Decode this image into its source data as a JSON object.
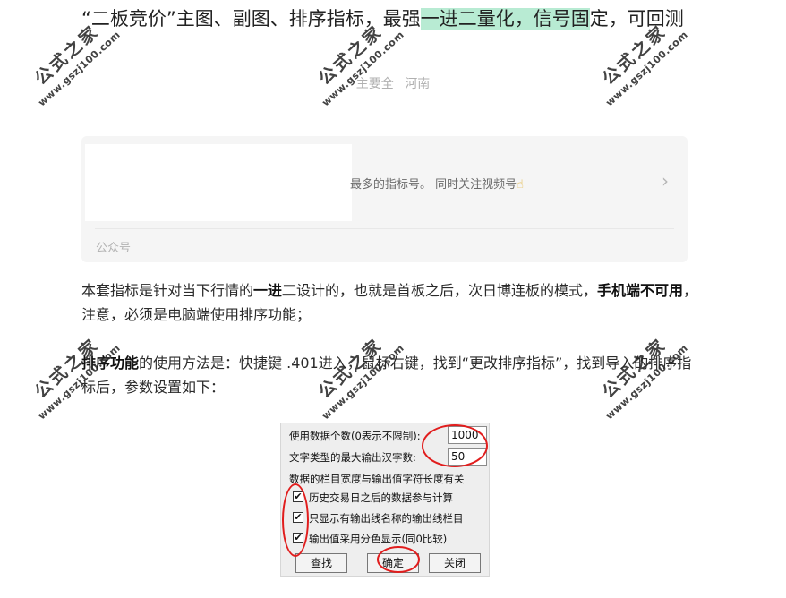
{
  "article": {
    "title_part1": "“二板竞价”主图、副图、排序指标，最强",
    "title_highlight": "一进二量化，信号固",
    "title_part2": "定，可回测",
    "meta_prefix": "主要全",
    "meta_location": "河南"
  },
  "card": {
    "description": "最多的指标号。 同时关注视频号",
    "hand_icon": "pointing-hand-icon",
    "chevron": "›",
    "source": "公众号"
  },
  "body": {
    "p1_a": "本套指标是针对当下行情的",
    "p1_b": "一进二",
    "p1_c": "设计的，也就是首板之后，次日博连板的模式，",
    "p1_d": "手机端不可用",
    "p1_e": "，注意，必须是电脑端使用排序功能；",
    "p2_a": "排序功能",
    "p2_b": "的使用方法是：快捷键 .401进入，鼠标右键，找到“更改排序指标”，找到导入的排序指标后，参数设置如下："
  },
  "dialog": {
    "data_count_label": "使用数据个数(0表示不限制):",
    "data_count_value": "1000",
    "max_chars_label": "文字类型的最大输出汉字数:",
    "max_chars_value": "50",
    "note": "数据的栏目宽度与输出值字符长度有关",
    "options": [
      {
        "label": "历史交易日之后的数据参与计算",
        "checked": true
      },
      {
        "label": "只显示有输出线名称的输出线栏目",
        "checked": true
      },
      {
        "label": "输出值采用分色显示(同0比较)",
        "checked": true
      }
    ],
    "check_mark": "✔",
    "find_button": "查找",
    "ok_button": "确定",
    "close_button": "关闭"
  },
  "watermark": {
    "title": "公式之家",
    "url": "www.gszj100.com"
  },
  "colors": {
    "highlight": "#b8ebd3",
    "annotation_ring": "#e11d1d"
  }
}
